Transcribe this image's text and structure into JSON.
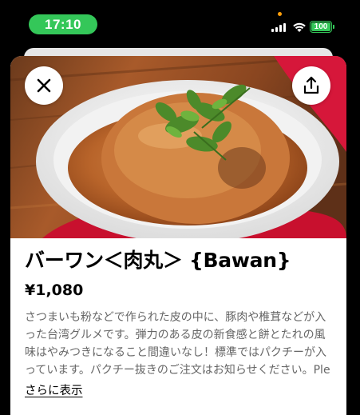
{
  "status_bar": {
    "time": "17:10",
    "battery": "100",
    "accent_color": "#34c759"
  },
  "sheet": {
    "close_icon": "close-icon",
    "share_icon": "share-icon"
  },
  "item": {
    "title": "バーワン＜肉丸＞ {Bawan}",
    "price": "¥1,080",
    "description": "さつまいも粉などで作られた皮の中に、豚肉や椎茸などが入った台湾グルメです。弾力のある皮の新食感と餅とたれの風味はやみつきになること間違いなし！標準ではパクチーが入っています。パクチー抜きのご注文はお知らせください。Please Enjoy the Combo of...",
    "more_label": "さらに表示"
  }
}
